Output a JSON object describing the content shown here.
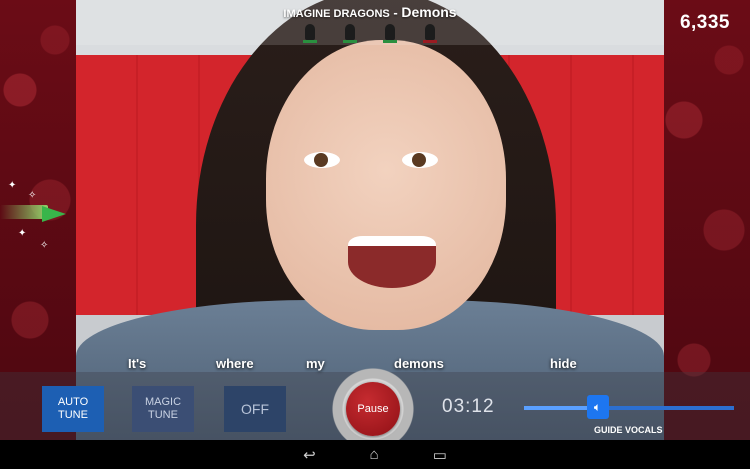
{
  "header": {
    "artist": "IMAGINE DRAGONS",
    "separator": "-",
    "song_title": "Demons",
    "mics": [
      {
        "icon": "microphone-icon",
        "color": "#2a8f3f"
      },
      {
        "icon": "microphone-icon",
        "color": "#2a8f3f"
      },
      {
        "icon": "microphone-icon",
        "color": "#2a8f3f"
      },
      {
        "icon": "microphone-icon",
        "color": "#9b1b22"
      }
    ]
  },
  "score": "6,335",
  "lyrics": {
    "words": [
      "It's",
      "where",
      "my",
      "demons",
      "hide"
    ]
  },
  "controls": {
    "auto_tune_line1": "AUTO",
    "auto_tune_line2": "TUNE",
    "magic_tune_line1": "MAGIC",
    "magic_tune_line2": "TUNE",
    "off_label": "OFF",
    "pause_label": "Pause",
    "elapsed_time": "03:12",
    "guide_vocals_label": "GUIDE VOCALS",
    "guide_vocals_level": 0.35
  },
  "colors": {
    "accent": "#1d5fb3",
    "pause": "#b2171d",
    "side_panel": "#5a0a12"
  },
  "navbar": {
    "icons": [
      "back-icon",
      "home-icon",
      "recents-icon"
    ]
  }
}
